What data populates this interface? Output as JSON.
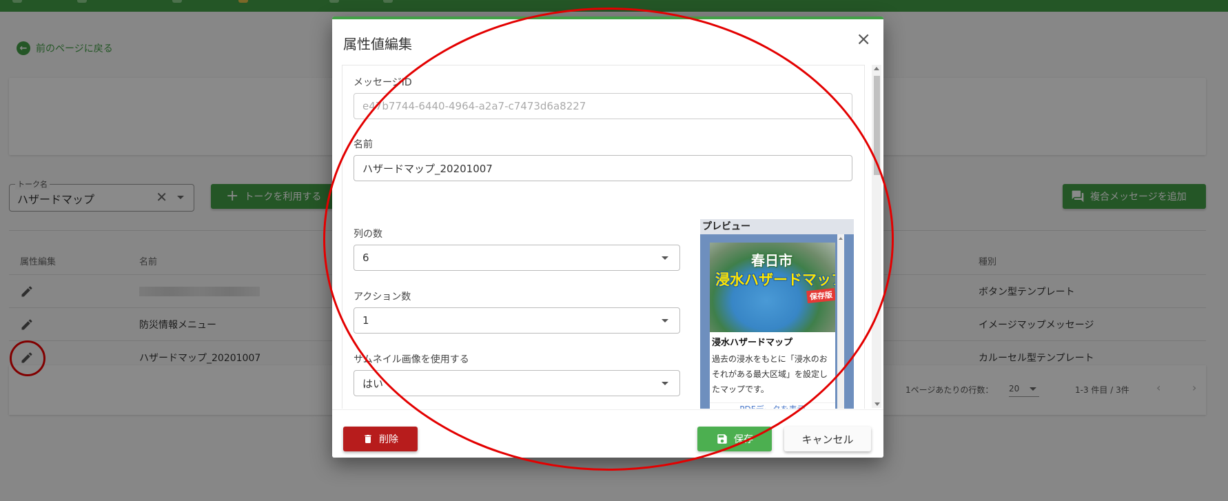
{
  "page": {
    "back_link": "前のページに戻る",
    "talk_field": {
      "label": "トーク名",
      "value": "ハザードマップ"
    },
    "use_talk_button": "トークを利用する",
    "add_composite_button": "複合メッセージを追加",
    "table": {
      "headers": {
        "edit": "属性編集",
        "name": "名前",
        "type": "種別"
      },
      "rows": [
        {
          "name": "",
          "type": "ボタン型テンプレート"
        },
        {
          "name": "防災情報メニュー",
          "type": "イメージマップメッセージ"
        },
        {
          "name": "ハザードマップ_20201007",
          "type": "カルーセル型テンプレート"
        }
      ]
    },
    "pager": {
      "rows_per_page_label": "1ページあたりの行数：",
      "rows_per_page": "20",
      "range": "1-3 件目 / 3件"
    }
  },
  "dialog": {
    "title": "属性値編集",
    "close_icon": "close-icon",
    "fields": {
      "message_id": {
        "label": "メッセージID",
        "value": "e47b7744-6440-4964-a2a7-c7473d6a8227"
      },
      "name": {
        "label": "名前",
        "value": "ハザードマップ_20201007"
      },
      "columns": {
        "label": "列の数",
        "value": "6"
      },
      "actions": {
        "label": "アクション数",
        "value": "1"
      },
      "thumbnail": {
        "label": "サムネイル画像を使用する",
        "value": "はい"
      }
    },
    "preview": {
      "label": "プレビュー",
      "image_city": "春日市",
      "image_title": "浸水ハザードマップ",
      "image_stamp": "保存版",
      "card_title": "浸水ハザードマップ",
      "card_text": "過去の浸水をもとに「浸水のおそれがある最大区域」を設定したマップです。",
      "card_link": "PDFデータを表示"
    },
    "buttons": {
      "delete": "削除",
      "save": "保存",
      "cancel": "キャンセル"
    }
  },
  "colors": {
    "primary": "#43a047",
    "danger": "#b71c1c",
    "annotation": "#e30000"
  }
}
